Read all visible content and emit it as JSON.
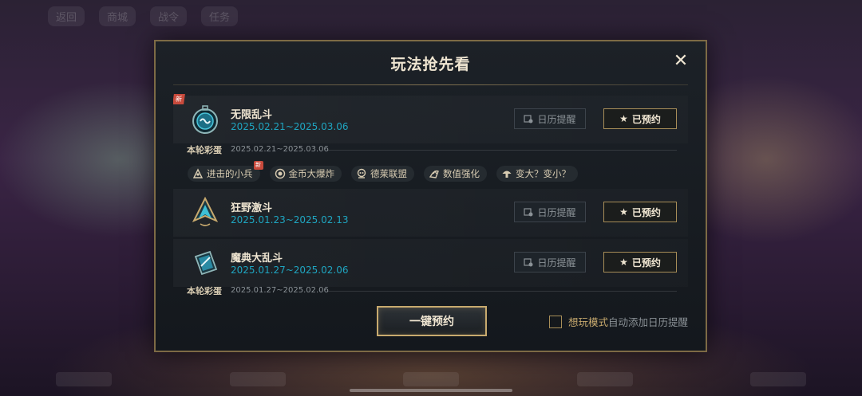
{
  "dialog": {
    "title": "玩法抢先看",
    "close_symbol": "✕"
  },
  "modes": [
    {
      "name": "无限乱斗",
      "date": "2025.02.21~2025.03.06",
      "is_new": true,
      "new_label": "新",
      "icon": "infinite-brawl-icon",
      "calendar_label": "日历提醒",
      "reserved_label": "已预约",
      "round_egg": {
        "label": "本轮彩蛋",
        "date": "2025.02.21~2025.03.06"
      }
    },
    {
      "name": "狂野激斗",
      "date": "2025.01.23~2025.02.13",
      "is_new": false,
      "icon": "wild-brawl-icon",
      "calendar_label": "日历提醒",
      "reserved_label": "已预约"
    },
    {
      "name": "魔典大乱斗",
      "date": "2025.01.27~2025.02.06",
      "is_new": false,
      "icon": "grimoire-brawl-icon",
      "calendar_label": "日历提醒",
      "reserved_label": "已预约",
      "round_egg": {
        "label": "本轮彩蛋",
        "date": "2025.01.27~2025.02.06"
      }
    }
  ],
  "egg_chips": [
    {
      "label": "进击的小兵",
      "icon": "minion-icon",
      "is_new": true,
      "new_label": "新"
    },
    {
      "label": "金币大爆炸",
      "icon": "gold-coin-icon",
      "is_new": false
    },
    {
      "label": "德莱联盟",
      "icon": "draven-icon",
      "is_new": false
    },
    {
      "label": "数值强化",
      "icon": "stat-boost-icon",
      "is_new": false
    },
    {
      "label": "变大？变小？",
      "icon": "mushroom-icon",
      "is_new": false
    }
  ],
  "footer": {
    "one_click_label": "一键预约",
    "auto_calendar_highlight": "想玩模式",
    "auto_calendar_rest": "自动添加日历提醒",
    "auto_calendar_checked": false
  },
  "background": {
    "top_bar": [
      "返回",
      "商城",
      "战令",
      "任务"
    ]
  },
  "colors": {
    "gold": "#c8aa6e",
    "accent_teal": "#1fa5c0",
    "text_light": "#f0e6d2",
    "text_muted": "#8b9297",
    "new_badge": "#c84a3c"
  }
}
